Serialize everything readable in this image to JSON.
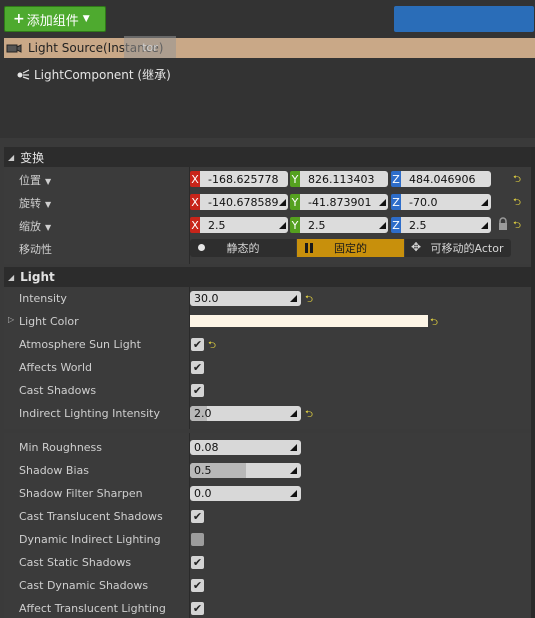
{
  "toolbar": {
    "add_component_label": "添加组件",
    "tooltip_text": "tor"
  },
  "tree": {
    "root_label": "Light Source(Instance)",
    "child_label": "LightComponent (继承)"
  },
  "transform": {
    "section_title": "变换",
    "location_label": "位置",
    "rotation_label": "旋转",
    "scale_label": "缩放",
    "mobility_label": "移动性",
    "axis": {
      "x": "X",
      "y": "Y",
      "z": "Z"
    },
    "location": {
      "x": "-168.625778",
      "y": "826.113403",
      "z": "484.046906"
    },
    "rotation": {
      "x": "-140.678589",
      "y": "-41.873901",
      "z": "-70.0"
    },
    "scale": {
      "x": "2.5",
      "y": "2.5",
      "z": "2.5"
    },
    "mobility_options": [
      "静态的",
      "固定的",
      "可移动的Actor"
    ],
    "mobility_selected": "固定的"
  },
  "light": {
    "section_title": "Light",
    "intensity_label": "Intensity",
    "intensity_value": "30.0",
    "light_color_label": "Light Color",
    "light_color_hex": "#fdf5e6",
    "atmosphere_sun_label": "Atmosphere Sun Light",
    "affects_world_label": "Affects World",
    "cast_shadows_label": "Cast Shadows",
    "indirect_intensity_label": "Indirect Lighting Intensity",
    "indirect_intensity_value": "2.0",
    "indirect_intensity_fill": 0.15
  },
  "advanced": {
    "min_roughness_label": "Min Roughness",
    "min_roughness_value": "0.08",
    "shadow_bias_label": "Shadow Bias",
    "shadow_bias_value": "0.5",
    "shadow_bias_fill": 0.5,
    "shadow_filter_label": "Shadow Filter Sharpen",
    "shadow_filter_value": "0.0",
    "cast_translucent_label": "Cast Translucent Shadows",
    "dynamic_indirect_label": "Dynamic Indirect Lighting",
    "cast_static_label": "Cast Static Shadows",
    "cast_dynamic_label": "Cast Dynamic Shadows",
    "affect_translucent_label": "Affect Translucent Lighting"
  },
  "checks": {
    "atmosphere_sun": true,
    "affects_world": true,
    "cast_shadows": true,
    "cast_translucent": true,
    "dynamic_indirect": false,
    "cast_static": true,
    "cast_dynamic": true,
    "affect_translucent": true
  },
  "colors": {
    "accent_green": "#4eaa2f",
    "selection_row": "#c9a887",
    "mobility_selected": "#c8900c",
    "axis_x": "#c8251a",
    "axis_y": "#55a11f",
    "axis_z": "#2e6dc9",
    "reset_arrow": "#e8d740"
  }
}
